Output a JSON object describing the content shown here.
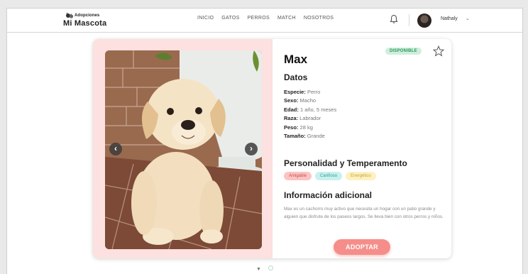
{
  "header": {
    "logo_top": "Adopciones",
    "logo_bottom": "Mi Mascota",
    "nav": [
      "INICIO",
      "GATOS",
      "PERROS",
      "MATCH",
      "NOSOTROS"
    ],
    "user_name": "Nathaly",
    "user_caret": "⌄"
  },
  "pet": {
    "name": "Max",
    "status": "DISPONIBLE",
    "datos_title": "Datos",
    "facts": [
      {
        "label": "Especie:",
        "value": "Perro"
      },
      {
        "label": "Sexo:",
        "value": "Macho"
      },
      {
        "label": "Edad:",
        "value": "1 año, 5 meses"
      },
      {
        "label": "Raza:",
        "value": "Labrador"
      },
      {
        "label": "Peso:",
        "value": "28 kg"
      },
      {
        "label": "Tamaño:",
        "value": "Grande"
      }
    ],
    "personality_title": "Personalidad y Temperamento",
    "tags": [
      {
        "label": "Amigable",
        "bg": "#fbc4c4",
        "color": "#d04c4c"
      },
      {
        "label": "Cariñoso",
        "bg": "#c8f1ee",
        "color": "#2f9b95"
      },
      {
        "label": "Energético",
        "bg": "#fdf1c0",
        "color": "#c6a43a"
      }
    ],
    "info_title": "Información adicional",
    "info_text": "Max es un cachorro muy activo que necesita un hogar con un patio grande y alguien que disfrute de los paseos largos. Se lleva bien con otros perros y niños.",
    "adopt_label": "ADOPTAR"
  },
  "carousel": {
    "prev_icon": "chevron-left-icon",
    "next_icon": "chevron-right-icon",
    "prev_glyph": "‹",
    "next_glyph": "›"
  },
  "pager": {
    "arrow_glyph": "▼"
  },
  "colors": {
    "accent": "#f58e8a",
    "available_bg": "#cfeedd",
    "available_text": "#2d9a5a",
    "card_left_bg": "#fde0e0"
  }
}
